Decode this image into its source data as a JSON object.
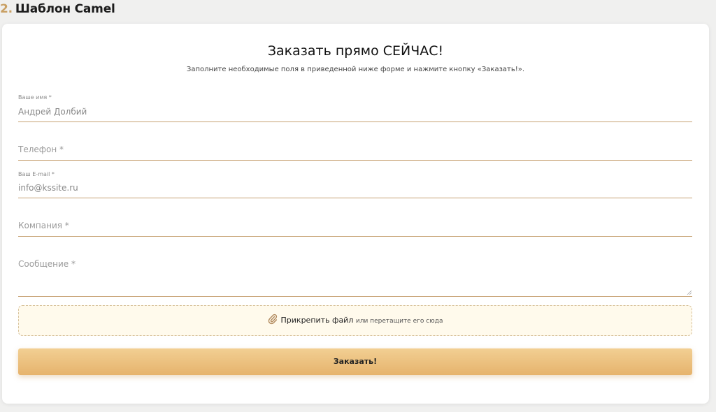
{
  "page": {
    "section_number": "2.",
    "section_title": "Шаблон Camel"
  },
  "form": {
    "title": "Заказать прямо СЕЙЧАС!",
    "subtitle": "Заполните необходимые поля в приведенной ниже форме и нажмите кнопку «Заказать!».",
    "fields": {
      "name": {
        "label": "Ваше имя *",
        "value": "Андрей Долбий"
      },
      "phone": {
        "placeholder": "Телефон *"
      },
      "email": {
        "label": "Ваш E-mail *",
        "value": "info@kssite.ru"
      },
      "company": {
        "placeholder": "Компания *"
      },
      "message": {
        "placeholder": "Сообщение *"
      }
    },
    "attachment": {
      "icon": "paperclip-icon",
      "action_label": "Прикрепить файл",
      "hint": "или перетащите его сюда"
    },
    "submit_label": "Заказать!"
  },
  "colors": {
    "accent": "#c9a064",
    "field_border": "#c6a172",
    "button_top": "#f2cf93",
    "button_bottom": "#e6b36d",
    "dropzone_bg": "#fffaec"
  }
}
